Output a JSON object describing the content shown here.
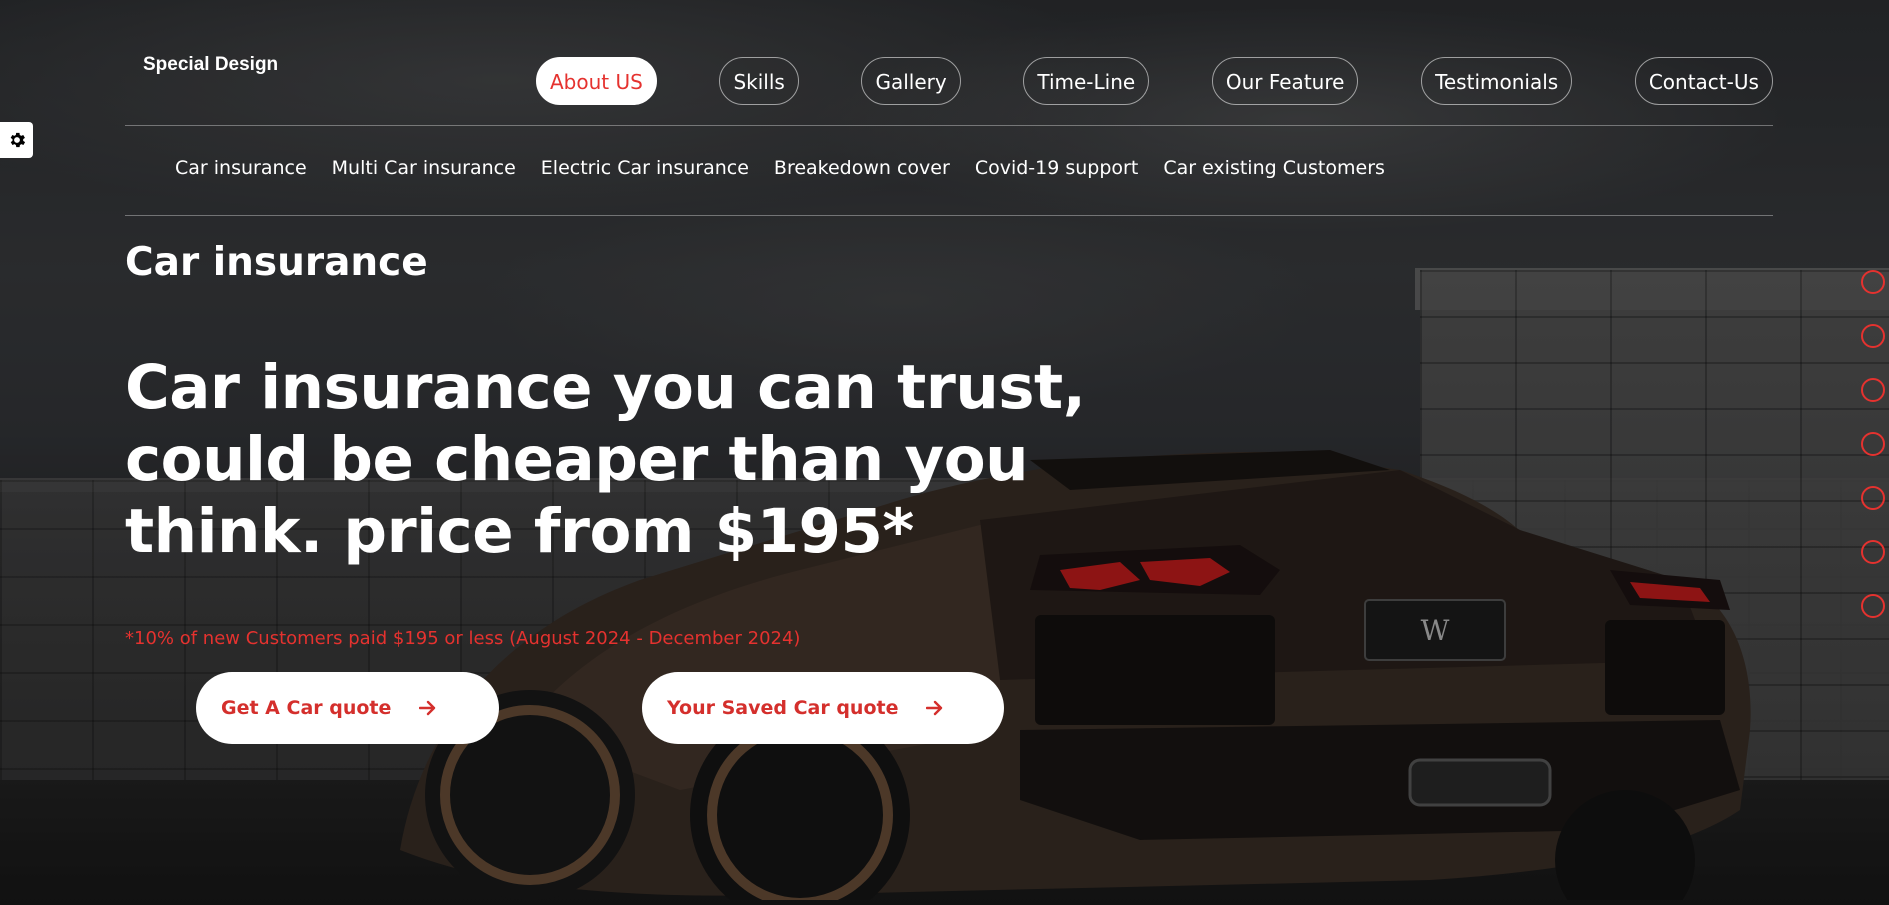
{
  "brand": {
    "logo_text": "Special Design"
  },
  "main_nav": {
    "items": [
      {
        "label": "About US",
        "active": true
      },
      {
        "label": "Skills",
        "active": false
      },
      {
        "label": "Gallery",
        "active": false
      },
      {
        "label": "Time-Line",
        "active": false
      },
      {
        "label": "Our Feature",
        "active": false
      },
      {
        "label": "Testimonials",
        "active": false
      },
      {
        "label": "Contact-Us",
        "active": false
      }
    ]
  },
  "sub_nav": {
    "items": [
      "Car insurance",
      "Multi Car insurance",
      "Electric Car insurance",
      "Breakedown cover",
      "Covid-19 support",
      "Car existing Customers"
    ]
  },
  "hero": {
    "section_title": "Car insurance",
    "headline_line1": "Car insurance you can trust,",
    "headline_line2": "could be cheaper than you",
    "headline_line3": "think. price from $195*",
    "footnote": "*10% of new Customers paid $195 or less (August 2024 - December 2024)",
    "primary_button": "Get A Car quote",
    "secondary_button": "Your Saved Car quote"
  },
  "side_bullets": {
    "count": 7
  },
  "settings": {
    "icon": "gear-icon"
  },
  "colors": {
    "accent": "#e5322f",
    "text_light": "#ffffff",
    "button_bg": "#ffffff"
  }
}
